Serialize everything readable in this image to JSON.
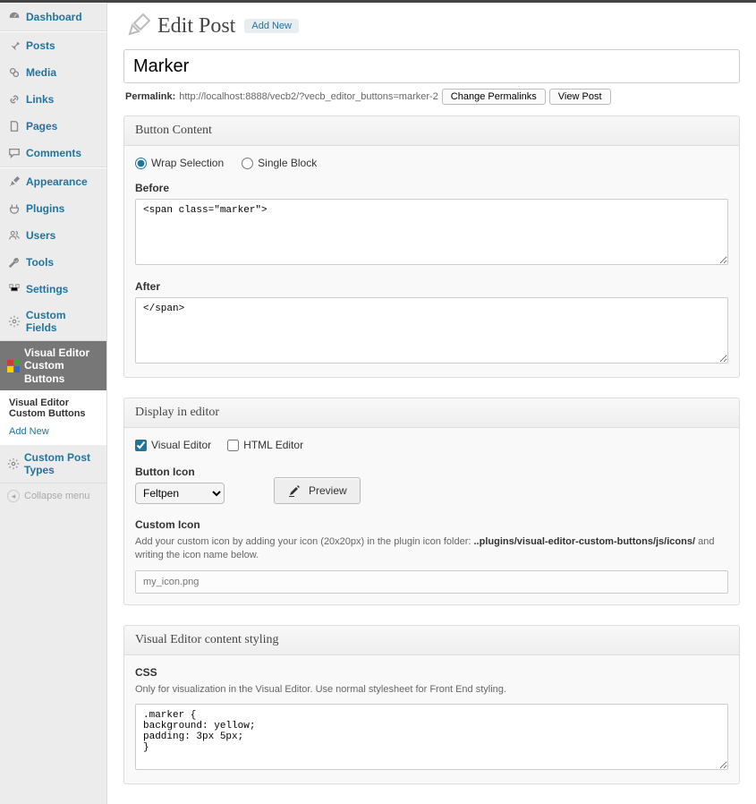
{
  "sidebar": {
    "groups": [
      [
        "Dashboard"
      ],
      [
        "Posts",
        "Media",
        "Links",
        "Pages",
        "Comments"
      ],
      [
        "Appearance",
        "Plugins",
        "Users",
        "Tools",
        "Settings",
        "Custom Fields"
      ]
    ],
    "current_label": "Visual Editor Custom Buttons",
    "submenu": [
      "Visual Editor Custom Buttons",
      "Add New"
    ],
    "after_current": [
      "Custom Post Types"
    ],
    "collapse": "Collapse menu"
  },
  "header": {
    "title": "Edit Post",
    "add_new": "Add New"
  },
  "post": {
    "title": "Marker",
    "permalink_label": "Permalink:",
    "permalink_url": "http://localhost:8888/vecb2/?vecb_editor_buttons=marker-2",
    "change_permalinks": "Change Permalinks",
    "view_post": "View Post"
  },
  "button_content": {
    "heading": "Button Content",
    "radio_wrap": "Wrap Selection",
    "radio_single": "Single Block",
    "before_label": "Before",
    "before_value": "<span class=\"marker\">",
    "after_label": "After",
    "after_value": "</span>"
  },
  "display": {
    "heading": "Display in editor",
    "visual_editor": "Visual Editor",
    "html_editor": "HTML Editor",
    "button_icon_label": "Button Icon",
    "icon_select": "Feltpen",
    "preview": "Preview",
    "custom_icon_label": "Custom Icon",
    "custom_icon_help_1": "Add your custom icon by adding your icon (20x20px) in the plugin icon folder: ",
    "custom_icon_help_bold": "..plugins/visual-editor-custom-buttons/js/icons/",
    "custom_icon_help_2": " and writing the icon name below.",
    "custom_icon_placeholder": "my_icon.png"
  },
  "styling": {
    "heading": "Visual Editor content styling",
    "css_label": "CSS",
    "css_help": "Only for visualization in the Visual Editor. Use normal stylesheet for Front End styling.",
    "css_value": ".marker {\nbackground: yellow;\npadding: 3px 5px;\n}"
  }
}
